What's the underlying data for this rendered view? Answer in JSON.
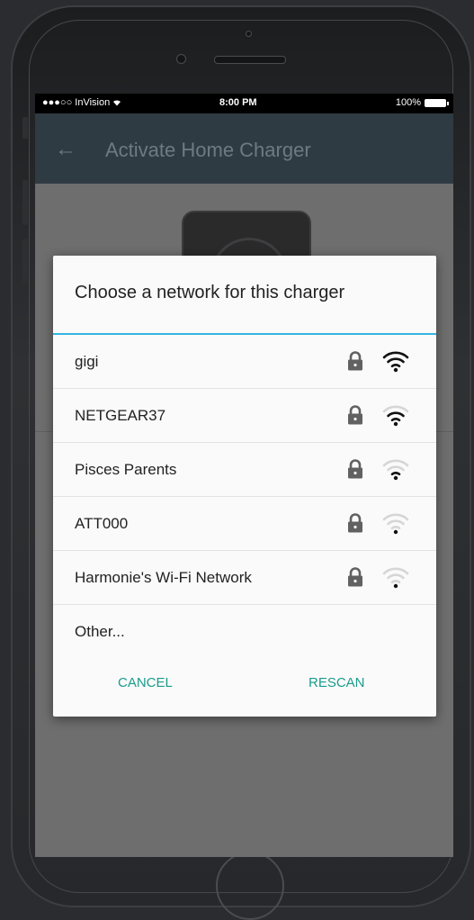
{
  "status_bar": {
    "carrier": "●●●○○ InVision",
    "time": "8:00 PM",
    "battery": "100%"
  },
  "app_bar": {
    "back_icon": "arrow-left-icon",
    "title": "Activate Home Charger"
  },
  "dialog": {
    "title": "Choose a network for this charger",
    "networks": [
      {
        "name": "gigi",
        "secured": true,
        "signal_bars": 3
      },
      {
        "name": "NETGEAR37",
        "secured": true,
        "signal_bars": 2
      },
      {
        "name": "Pisces Parents",
        "secured": true,
        "signal_bars": 1
      },
      {
        "name": "ATT000",
        "secured": true,
        "signal_bars": 0
      },
      {
        "name": "Harmonie's Wi-Fi Network",
        "secured": true,
        "signal_bars": 0
      }
    ],
    "other_label": "Other...",
    "cancel_label": "CANCEL",
    "rescan_label": "RESCAN"
  },
  "colors": {
    "accent": "#33b5e5",
    "button_text": "#1a9c8c",
    "app_bar": "#2f3b42"
  }
}
